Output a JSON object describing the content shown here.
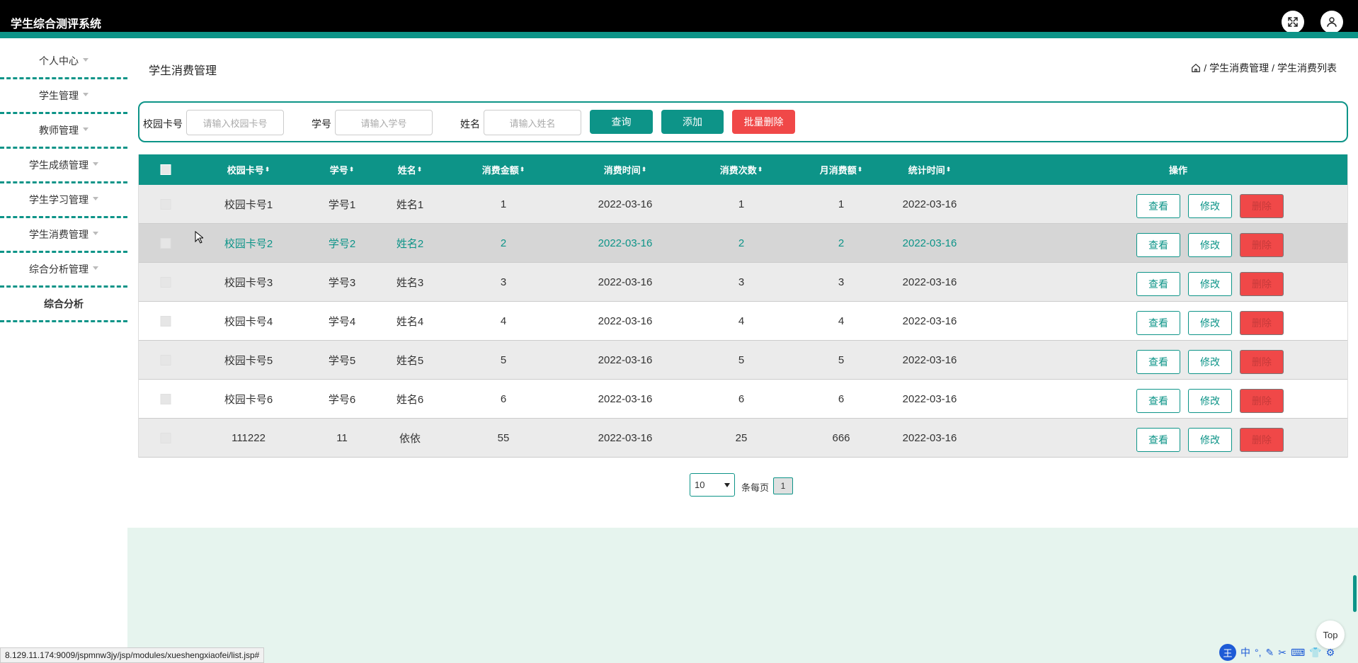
{
  "app": {
    "title": "学生综合测评系统"
  },
  "header": {
    "fullscreen_icon": "expand-icon",
    "user_icon": "user-icon"
  },
  "sidebar": {
    "items": [
      {
        "label": "个人中心",
        "dropdown": true
      },
      {
        "label": "学生管理",
        "dropdown": true
      },
      {
        "label": "教师管理",
        "dropdown": true
      },
      {
        "label": "学生成绩管理",
        "dropdown": true
      },
      {
        "label": "学生学习管理",
        "dropdown": true
      },
      {
        "label": "学生消费管理",
        "dropdown": true
      },
      {
        "label": "综合分析管理",
        "dropdown": true
      },
      {
        "label": "综合分析",
        "dropdown": false
      }
    ]
  },
  "page": {
    "title": "学生消费管理",
    "breadcrumb": [
      "学生消费管理",
      "学生消费列表"
    ],
    "breadcrumb_sep": "/"
  },
  "search": {
    "card_label": "校园卡号",
    "card_placeholder": "请输入校园卡号",
    "id_label": "学号",
    "id_placeholder": "请输入学号",
    "name_label": "姓名",
    "name_placeholder": "请输入姓名",
    "query_button": "查询",
    "add_button": "添加",
    "batch_delete_button": "批量删除"
  },
  "table": {
    "headers": [
      "校园卡号",
      "学号",
      "姓名",
      "消费金额",
      "消费时间",
      "消费次数",
      "月消费额",
      "统计时间",
      "操作"
    ],
    "sort_glyph": "⬍",
    "actions": {
      "view": "查看",
      "edit": "修改",
      "delete": "删除"
    },
    "rows": [
      [
        "校园卡号1",
        "学号1",
        "姓名1",
        "1",
        "2022-03-16",
        "1",
        "1",
        "2022-03-16"
      ],
      [
        "校园卡号2",
        "学号2",
        "姓名2",
        "2",
        "2022-03-16",
        "2",
        "2",
        "2022-03-16"
      ],
      [
        "校园卡号3",
        "学号3",
        "姓名3",
        "3",
        "2022-03-16",
        "3",
        "3",
        "2022-03-16"
      ],
      [
        "校园卡号4",
        "学号4",
        "姓名4",
        "4",
        "2022-03-16",
        "4",
        "4",
        "2022-03-16"
      ],
      [
        "校园卡号5",
        "学号5",
        "姓名5",
        "5",
        "2022-03-16",
        "5",
        "5",
        "2022-03-16"
      ],
      [
        "校园卡号6",
        "学号6",
        "姓名6",
        "6",
        "2022-03-16",
        "6",
        "6",
        "2022-03-16"
      ],
      [
        "111222",
        "11",
        "依依",
        "55",
        "2022-03-16",
        "25",
        "666",
        "2022-03-16"
      ]
    ]
  },
  "pagination": {
    "page_size": "10",
    "per_page_label": "条每页",
    "current_page": "1"
  },
  "back_to_top": "Top",
  "status_url": "8.129.11.174:9009/jspmnw3jy/jsp/modules/xueshengxiaofei/list.jsp#",
  "tray": {
    "ime": "王",
    "lang": "中"
  },
  "colors": {
    "accent": "#0d9488",
    "danger": "#f04848",
    "footer_bg": "#e6f4ee"
  }
}
